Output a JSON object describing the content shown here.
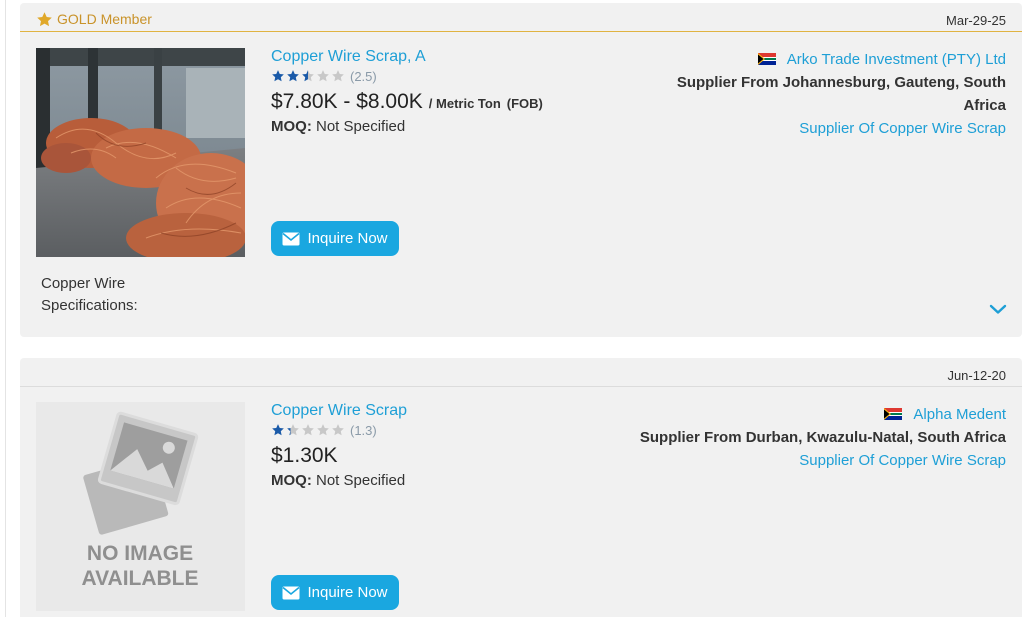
{
  "listings": [
    {
      "member_label": "GOLD Member",
      "date": "Mar-29-25",
      "title": "Copper Wire Scrap, A",
      "rating": "(2.5)",
      "rating_value": 2.5,
      "price": "$7.80K - $8.00K",
      "unit": "/ Metric Ton",
      "terms": "(FOB)",
      "moq_label": "MOQ:",
      "moq_value": "Not Specified",
      "inquire_label": "Inquire Now",
      "caption": "Copper Wire Specifications:",
      "supplier_name": "Arko Trade Investment (PTY) Ltd",
      "supplier_location": "Supplier From Johannesburg, Gauteng, South Africa",
      "supplier_category": "Supplier Of Copper Wire Scrap",
      "image_icon": "copper-wire-photo"
    },
    {
      "date": "Jun-12-20",
      "title": "Copper Wire Scrap",
      "rating": "(1.3)",
      "rating_value": 1.3,
      "price": "$1.30K",
      "moq_label": "MOQ:",
      "moq_value": "Not Specified",
      "inquire_label": "Inquire Now",
      "no_image_line1": "NO IMAGE",
      "no_image_line2": "AVAILABLE",
      "supplier_name": "Alpha Medent",
      "supplier_location": "Supplier From Durban, Kwazulu-Natal, South Africa",
      "supplier_category": "Supplier Of Copper Wire Scrap",
      "image_icon": "no-image-placeholder-icon"
    }
  ],
  "icons": {
    "member": "star-icon",
    "inquire": "envelope-icon",
    "flag": "south-africa-flag-icon",
    "expand": "chevron-down-icon"
  },
  "colors": {
    "link": "#1e9fd6",
    "button": "#1aa7e0",
    "gold": "#e0b341",
    "star_filled": "#1a5aa8",
    "star_empty": "#c8c8c8",
    "card_bg": "#f1f1f1"
  }
}
